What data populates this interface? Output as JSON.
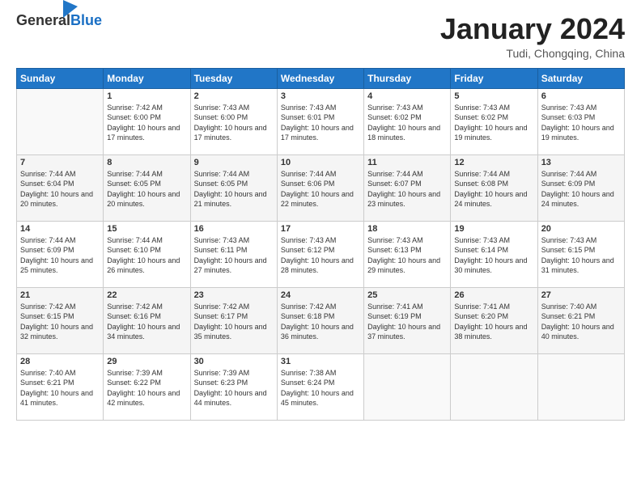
{
  "header": {
    "logo_general": "General",
    "logo_blue": "Blue",
    "month_title": "January 2024",
    "location": "Tudi, Chongqing, China"
  },
  "weekdays": [
    "Sunday",
    "Monday",
    "Tuesday",
    "Wednesday",
    "Thursday",
    "Friday",
    "Saturday"
  ],
  "weeks": [
    [
      {
        "day": "",
        "sunrise": "",
        "sunset": "",
        "daylight": ""
      },
      {
        "day": "1",
        "sunrise": "Sunrise: 7:42 AM",
        "sunset": "Sunset: 6:00 PM",
        "daylight": "Daylight: 10 hours and 17 minutes."
      },
      {
        "day": "2",
        "sunrise": "Sunrise: 7:43 AM",
        "sunset": "Sunset: 6:00 PM",
        "daylight": "Daylight: 10 hours and 17 minutes."
      },
      {
        "day": "3",
        "sunrise": "Sunrise: 7:43 AM",
        "sunset": "Sunset: 6:01 PM",
        "daylight": "Daylight: 10 hours and 17 minutes."
      },
      {
        "day": "4",
        "sunrise": "Sunrise: 7:43 AM",
        "sunset": "Sunset: 6:02 PM",
        "daylight": "Daylight: 10 hours and 18 minutes."
      },
      {
        "day": "5",
        "sunrise": "Sunrise: 7:43 AM",
        "sunset": "Sunset: 6:02 PM",
        "daylight": "Daylight: 10 hours and 19 minutes."
      },
      {
        "day": "6",
        "sunrise": "Sunrise: 7:43 AM",
        "sunset": "Sunset: 6:03 PM",
        "daylight": "Daylight: 10 hours and 19 minutes."
      }
    ],
    [
      {
        "day": "7",
        "sunrise": "Sunrise: 7:44 AM",
        "sunset": "Sunset: 6:04 PM",
        "daylight": "Daylight: 10 hours and 20 minutes."
      },
      {
        "day": "8",
        "sunrise": "Sunrise: 7:44 AM",
        "sunset": "Sunset: 6:05 PM",
        "daylight": "Daylight: 10 hours and 20 minutes."
      },
      {
        "day": "9",
        "sunrise": "Sunrise: 7:44 AM",
        "sunset": "Sunset: 6:05 PM",
        "daylight": "Daylight: 10 hours and 21 minutes."
      },
      {
        "day": "10",
        "sunrise": "Sunrise: 7:44 AM",
        "sunset": "Sunset: 6:06 PM",
        "daylight": "Daylight: 10 hours and 22 minutes."
      },
      {
        "day": "11",
        "sunrise": "Sunrise: 7:44 AM",
        "sunset": "Sunset: 6:07 PM",
        "daylight": "Daylight: 10 hours and 23 minutes."
      },
      {
        "day": "12",
        "sunrise": "Sunrise: 7:44 AM",
        "sunset": "Sunset: 6:08 PM",
        "daylight": "Daylight: 10 hours and 24 minutes."
      },
      {
        "day": "13",
        "sunrise": "Sunrise: 7:44 AM",
        "sunset": "Sunset: 6:09 PM",
        "daylight": "Daylight: 10 hours and 24 minutes."
      }
    ],
    [
      {
        "day": "14",
        "sunrise": "Sunrise: 7:44 AM",
        "sunset": "Sunset: 6:09 PM",
        "daylight": "Daylight: 10 hours and 25 minutes."
      },
      {
        "day": "15",
        "sunrise": "Sunrise: 7:44 AM",
        "sunset": "Sunset: 6:10 PM",
        "daylight": "Daylight: 10 hours and 26 minutes."
      },
      {
        "day": "16",
        "sunrise": "Sunrise: 7:43 AM",
        "sunset": "Sunset: 6:11 PM",
        "daylight": "Daylight: 10 hours and 27 minutes."
      },
      {
        "day": "17",
        "sunrise": "Sunrise: 7:43 AM",
        "sunset": "Sunset: 6:12 PM",
        "daylight": "Daylight: 10 hours and 28 minutes."
      },
      {
        "day": "18",
        "sunrise": "Sunrise: 7:43 AM",
        "sunset": "Sunset: 6:13 PM",
        "daylight": "Daylight: 10 hours and 29 minutes."
      },
      {
        "day": "19",
        "sunrise": "Sunrise: 7:43 AM",
        "sunset": "Sunset: 6:14 PM",
        "daylight": "Daylight: 10 hours and 30 minutes."
      },
      {
        "day": "20",
        "sunrise": "Sunrise: 7:43 AM",
        "sunset": "Sunset: 6:15 PM",
        "daylight": "Daylight: 10 hours and 31 minutes."
      }
    ],
    [
      {
        "day": "21",
        "sunrise": "Sunrise: 7:42 AM",
        "sunset": "Sunset: 6:15 PM",
        "daylight": "Daylight: 10 hours and 32 minutes."
      },
      {
        "day": "22",
        "sunrise": "Sunrise: 7:42 AM",
        "sunset": "Sunset: 6:16 PM",
        "daylight": "Daylight: 10 hours and 34 minutes."
      },
      {
        "day": "23",
        "sunrise": "Sunrise: 7:42 AM",
        "sunset": "Sunset: 6:17 PM",
        "daylight": "Daylight: 10 hours and 35 minutes."
      },
      {
        "day": "24",
        "sunrise": "Sunrise: 7:42 AM",
        "sunset": "Sunset: 6:18 PM",
        "daylight": "Daylight: 10 hours and 36 minutes."
      },
      {
        "day": "25",
        "sunrise": "Sunrise: 7:41 AM",
        "sunset": "Sunset: 6:19 PM",
        "daylight": "Daylight: 10 hours and 37 minutes."
      },
      {
        "day": "26",
        "sunrise": "Sunrise: 7:41 AM",
        "sunset": "Sunset: 6:20 PM",
        "daylight": "Daylight: 10 hours and 38 minutes."
      },
      {
        "day": "27",
        "sunrise": "Sunrise: 7:40 AM",
        "sunset": "Sunset: 6:21 PM",
        "daylight": "Daylight: 10 hours and 40 minutes."
      }
    ],
    [
      {
        "day": "28",
        "sunrise": "Sunrise: 7:40 AM",
        "sunset": "Sunset: 6:21 PM",
        "daylight": "Daylight: 10 hours and 41 minutes."
      },
      {
        "day": "29",
        "sunrise": "Sunrise: 7:39 AM",
        "sunset": "Sunset: 6:22 PM",
        "daylight": "Daylight: 10 hours and 42 minutes."
      },
      {
        "day": "30",
        "sunrise": "Sunrise: 7:39 AM",
        "sunset": "Sunset: 6:23 PM",
        "daylight": "Daylight: 10 hours and 44 minutes."
      },
      {
        "day": "31",
        "sunrise": "Sunrise: 7:38 AM",
        "sunset": "Sunset: 6:24 PM",
        "daylight": "Daylight: 10 hours and 45 minutes."
      },
      {
        "day": "",
        "sunrise": "",
        "sunset": "",
        "daylight": ""
      },
      {
        "day": "",
        "sunrise": "",
        "sunset": "",
        "daylight": ""
      },
      {
        "day": "",
        "sunrise": "",
        "sunset": "",
        "daylight": ""
      }
    ]
  ]
}
